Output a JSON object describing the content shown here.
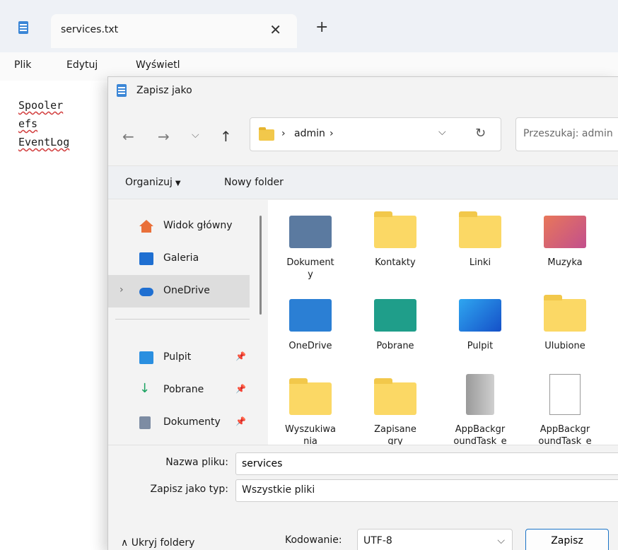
{
  "notepad": {
    "tab_title": "services.txt",
    "tab_close": "✕",
    "tab_add": "+",
    "menu": [
      "Plik",
      "Edytuj",
      "Wyświetl"
    ],
    "lines": [
      "Spooler",
      "efs",
      "EventLog"
    ]
  },
  "dialog": {
    "title": "Zapisz jako",
    "nav": {
      "back": "←",
      "forward": "→",
      "recent": "⌵",
      "up": "↑"
    },
    "address": {
      "segment": "admin",
      "sep": "›",
      "dropdown": "⌵",
      "refresh": "↻"
    },
    "search_placeholder": "Przeszukaj: admin",
    "commands": {
      "organize": "Organizuj",
      "organize_caret": "▼",
      "new_folder": "Nowy folder"
    },
    "sidebar": [
      {
        "label": "Widok główny",
        "icon": "home-icon"
      },
      {
        "label": "Galeria",
        "icon": "gallery-icon"
      },
      {
        "label": "OneDrive",
        "icon": "onedrive-icon",
        "chevron": "›"
      },
      {
        "label": "Pulpit",
        "icon": "desktop-icon",
        "pin": "📌"
      },
      {
        "label": "Pobrane",
        "icon": "download-icon",
        "pin": "📌"
      },
      {
        "label": "Dokumenty",
        "icon": "documents-icon",
        "pin": "📌"
      }
    ],
    "items": [
      {
        "label": "Dokument\ny",
        "icon": "documents-folder-icon"
      },
      {
        "label": "Kontakty",
        "icon": "folder-icon"
      },
      {
        "label": "Linki",
        "icon": "folder-icon"
      },
      {
        "label": "Muzyka",
        "icon": "music-folder-icon"
      },
      {
        "label": "OneDrive",
        "icon": "onedrive-folder-icon"
      },
      {
        "label": "Pobrane",
        "icon": "downloads-folder-icon"
      },
      {
        "label": "Pulpit",
        "icon": "desktop-folder-icon"
      },
      {
        "label": "Ulubione",
        "icon": "folder-icon"
      },
      {
        "label": "Wyszukiwa\nnia",
        "icon": "folder-icon"
      },
      {
        "label": "Zapisane\ngry",
        "icon": "folder-icon"
      },
      {
        "label": "AppBackgr\noundTask_e",
        "icon": "cabinet-icon"
      },
      {
        "label": "AppBackgr\noundTask_e",
        "icon": "file-icon"
      }
    ],
    "filename_label": "Nazwa pliku:",
    "filename_value": "services",
    "type_label": "Zapisz jako typ:",
    "type_value": "Wszystkie pliki",
    "hide_folders": "Ukryj foldery",
    "hide_caret": "∧",
    "encoding_label": "Kodowanie:",
    "encoding_value": "UTF-8",
    "encoding_caret": "⌵",
    "save_button": "Zapisz"
  },
  "colors": {
    "accent": "#1a73c7",
    "folder": "#fbd865",
    "selected_row": "#dddddd"
  }
}
